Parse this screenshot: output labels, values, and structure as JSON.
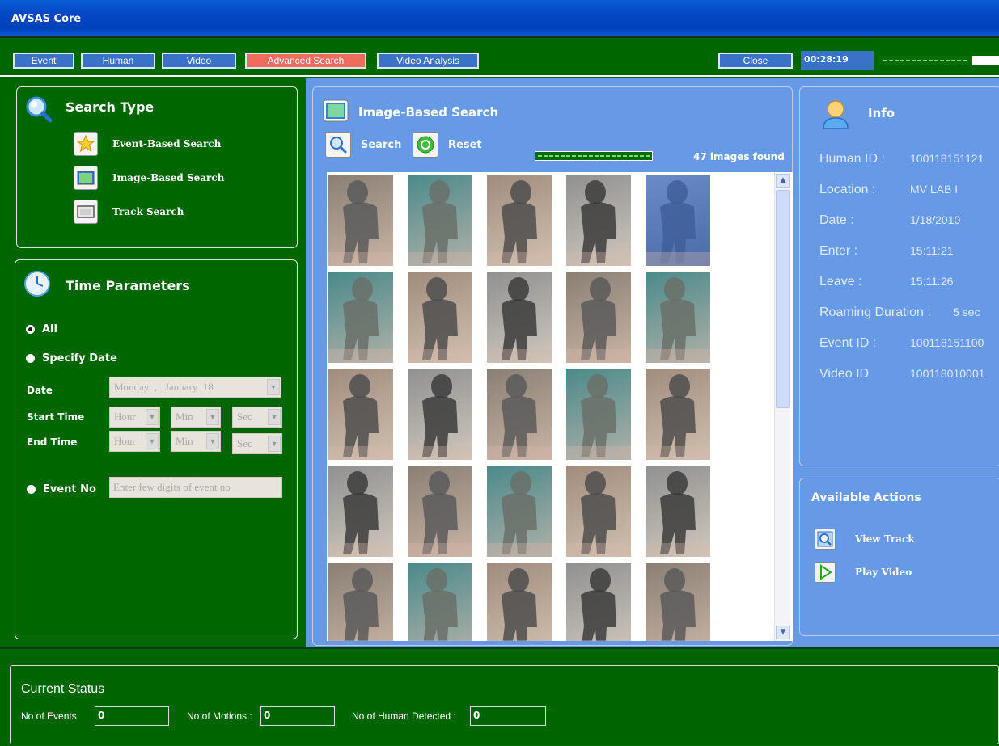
{
  "window": {
    "title": "AVSAS Core"
  },
  "toolbar": {
    "tabs": [
      {
        "label": "Event"
      },
      {
        "label": "Human"
      },
      {
        "label": "Video"
      },
      {
        "label": "Advanced Search",
        "active": true
      },
      {
        "label": "Video Analysis"
      }
    ],
    "close_label": "Close",
    "elapsed_time": "00:28:19",
    "progress_fraction": 0.78
  },
  "search_type": {
    "title": "Search Type",
    "items": [
      {
        "label": "Event-Based Search",
        "icon": "star-icon"
      },
      {
        "label": "Image-Based Search",
        "icon": "image-icon"
      },
      {
        "label": "Track Search",
        "icon": "track-icon"
      }
    ]
  },
  "time_params": {
    "title": "Time Parameters",
    "all_label": "All",
    "specify_label": "Specify Date",
    "selected": "all",
    "date_label": "Date",
    "date_value_day": "Monday",
    "date_value_month": "January",
    "date_value_num": "18",
    "start_label": "Start Time",
    "end_label": "End Time",
    "hour_placeholder": "Hour",
    "min_placeholder": "Min",
    "sec_placeholder": "Sec",
    "event_no_label": "Event No",
    "event_no_placeholder": "Enter few digits of  event no"
  },
  "image_search": {
    "title": "Image-Based Search",
    "search_label": "Search",
    "reset_label": "Reset",
    "progress_fraction": 1.0,
    "found_text": "47 images found"
  },
  "info": {
    "title": "Info",
    "rows": [
      {
        "key": "Human ID :",
        "value": "100118151121"
      },
      {
        "key": "Location :",
        "value": "MV LAB I"
      },
      {
        "key": "Date :",
        "value": "1/18/2010"
      },
      {
        "key": "Enter :",
        "value": "15:11:21"
      },
      {
        "key": "Leave :",
        "value": "15:11:26"
      },
      {
        "key": "Roaming Duration :",
        "value": "5 sec"
      },
      {
        "key": "Event ID :",
        "value": "100118151100"
      },
      {
        "key": "Video ID",
        "value": "100118010001"
      }
    ]
  },
  "actions": {
    "title": "Available Actions",
    "items": [
      {
        "label": "View Track",
        "icon": "view-track-icon"
      },
      {
        "label": "Play Video",
        "icon": "play-icon"
      }
    ]
  },
  "status": {
    "title": "Current Status",
    "events_label": "No of  Events",
    "events_value": "0",
    "motions_label": "No of Motions :",
    "motions_value": "0",
    "humans_label": "No of Human Detected :",
    "humans_value": "0"
  },
  "colors": {
    "window_green": "#006600",
    "panel_blue": "#6699e6",
    "tab_blue": "#3a72c8",
    "tab_active": "#f06b5c"
  }
}
